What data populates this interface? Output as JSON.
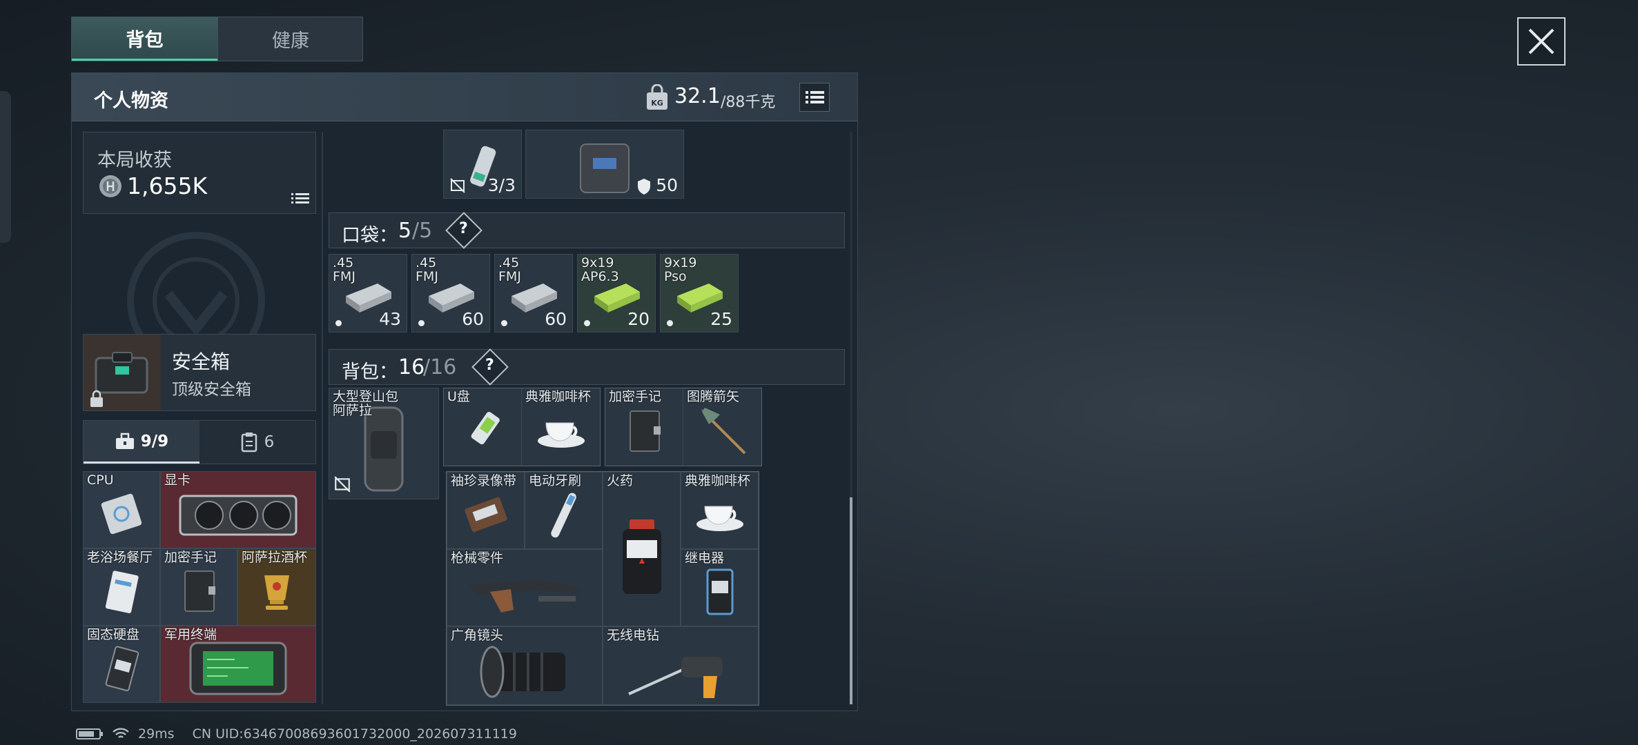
{
  "tabs": [
    {
      "label": "背包",
      "active": true
    },
    {
      "label": "健康",
      "active": false
    }
  ],
  "panel": {
    "title": "个人物资",
    "weight": {
      "current": "32.1",
      "max": "/88千克"
    }
  },
  "harvest": {
    "label": "本局收获",
    "value": "1,655K"
  },
  "safebox": {
    "title": "安全箱",
    "subtitle": "顶级安全箱"
  },
  "side_tabs": [
    {
      "label": "9/9",
      "icon": "toolbox-icon"
    },
    {
      "label": "6",
      "icon": "clipboard-icon"
    }
  ],
  "safebox_items": [
    {
      "name": "CPU",
      "tint": "#2e3a48"
    },
    {
      "name": "显卡",
      "tint": "#5a2a32"
    },
    {
      "name": "老浴场餐厅",
      "tint": "#2e3a48"
    },
    {
      "name": "加密手记",
      "tint": "#2e3a48"
    },
    {
      "name": "阿萨拉酒杯",
      "tint": "#4a3a22"
    },
    {
      "name": "固态硬盘",
      "tint": "#2e3a48"
    },
    {
      "name": "军用终端",
      "tint": "#5a2a32"
    }
  ],
  "top_items": [
    {
      "count": "3/3"
    },
    {
      "count": "50"
    }
  ],
  "pocket": {
    "label": "口袋：",
    "used": "5",
    "total": "/5",
    "help": "?",
    "items": [
      {
        "line1": ".45",
        "line2": "FMJ",
        "count": "43",
        "color": "gray"
      },
      {
        "line1": ".45",
        "line2": "FMJ",
        "count": "60",
        "color": "gray"
      },
      {
        "line1": ".45",
        "line2": "FMJ",
        "count": "60",
        "color": "gray"
      },
      {
        "line1": "9x19",
        "line2": "AP6.3",
        "count": "20",
        "color": "green"
      },
      {
        "line1": "9x19",
        "line2": "Pso",
        "count": "25",
        "color": "green"
      }
    ]
  },
  "backpack": {
    "label": "背包：",
    "used": "16",
    "total": "/16",
    "help": "?",
    "equipped": {
      "name": "大型登山包",
      "name2": "阿萨拉"
    },
    "row1": [
      "U盘",
      "典雅咖啡杯",
      "加密手记",
      "图腾箭矢"
    ],
    "grid": [
      "袖珍录像带",
      "电动牙刷",
      "火药",
      "典雅咖啡杯",
      "枪械零件",
      "继电器",
      "广角镜头",
      "无线电钻"
    ]
  },
  "status": {
    "ping": "29ms",
    "uid": "CN UID:634670086936017320​00_202607311119"
  }
}
